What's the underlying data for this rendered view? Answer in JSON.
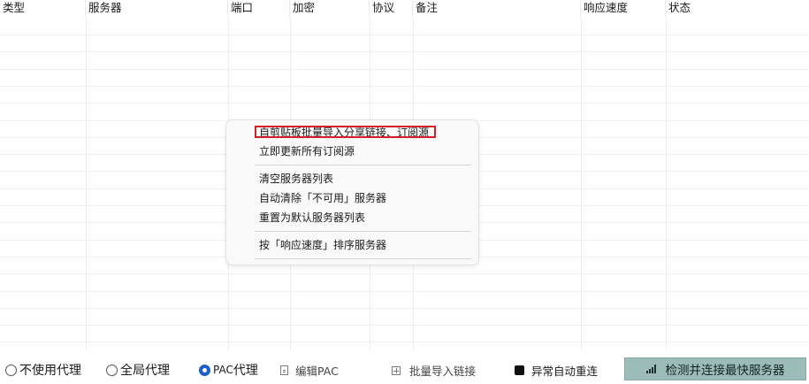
{
  "table": {
    "columns": [
      "类型",
      "服务器",
      "端口",
      "加密",
      "协议",
      "备注",
      "响应速度",
      "状态"
    ]
  },
  "context_menu": {
    "items": [
      {
        "label": "自剪贴板批量导入分享链接、订阅源"
      },
      {
        "label": "立即更新所有订阅源"
      },
      {
        "label": "清空服务器列表"
      },
      {
        "label": "自动清除「不可用」服务器"
      },
      {
        "label": "重置为默认服务器列表"
      },
      {
        "label": "按「响应速度」排序服务器"
      }
    ]
  },
  "bottom_bar": {
    "radio_no_proxy": "不使用代理",
    "radio_global": "全局代理",
    "radio_pac_prefix": "PAC",
    "radio_pac_suffix": "代理",
    "edit_pac": "编辑PAC",
    "batch_import": "批量导入链接",
    "auto_reconnect": "异常自动重连",
    "fastest_button": "检测并连接最快服务器",
    "selected_mode": "PAC代理"
  },
  "colors": {
    "highlight": "#d21f2b",
    "radio_selected": "#1e5ec8",
    "button_bg": "#9cbcb9"
  }
}
